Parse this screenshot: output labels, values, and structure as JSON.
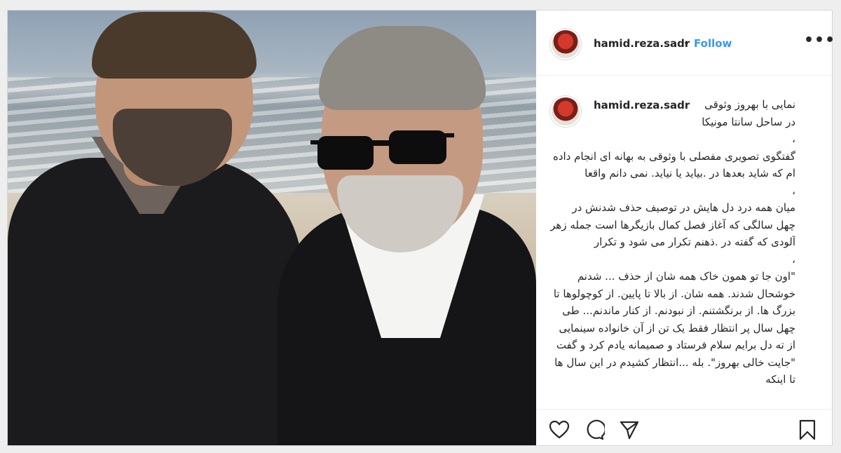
{
  "post": {
    "username": "hamid.reza.sadr",
    "separator": "•",
    "follow_label": "Follow",
    "more_label": "•••",
    "caption_first": "نمایی با بهروز وثوقی\nدر ساحل سانتا مونیکا",
    "caption_body": "\n،\nگفتگوی تصویری مفصلی با وثوقی به بهانه ای انجام داده ام که شاید بعدها در .بیاید یا نیاید. نمی دانم واقعا\n،\nمیان همه درد دل هایش در توصیف حذف شدنش در چهل سالگی که آغاز فصل کمال بازیگرها است جمله زهر آلودی که گفته در .ذهنم تکرار می شود و تکرار\n،\n\"اون جا تو همون خاک همه شان از حذف ... شدنم خوشحال شدند. همه شان. از بالا تا پایین. از کوچولوها تا بزرگ ها. از برنگشتنم. از نبودنم. از کنار ماندنم... طی چهل سال پر انتظار فقط یک تن از آن خانواده سینمایی از ته دل برایم سلام فرستاد و صمیمانه یادم کرد و گفت \"جایت خالی بهروز\". بله ...انتظار کشیدم در این سال ها تا اینکه"
  },
  "icons": {
    "like": "heart-icon",
    "comment": "comment-bubble-icon",
    "share": "paper-plane-icon",
    "save": "bookmark-icon",
    "more": "more-dots-icon"
  },
  "colors": {
    "follow": "#3897f0",
    "text": "#262626"
  }
}
